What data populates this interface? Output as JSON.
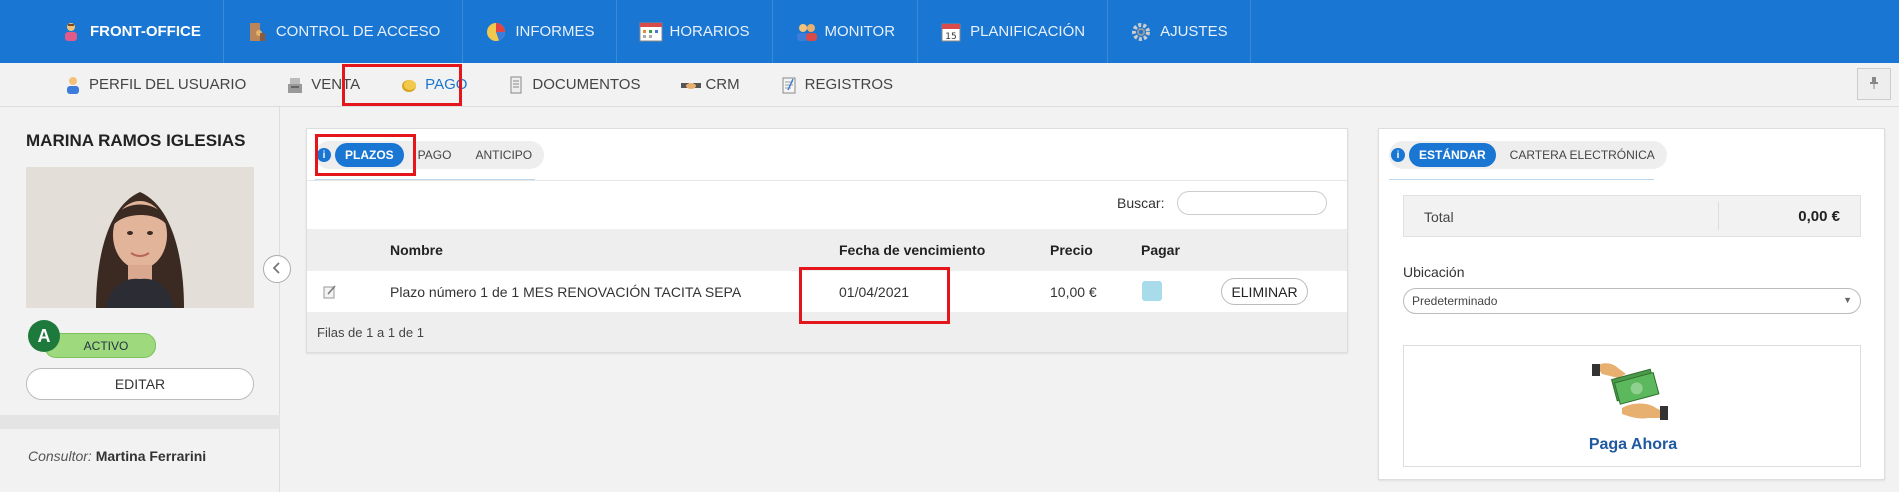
{
  "topnav": {
    "items": [
      {
        "label": "FRONT-OFFICE",
        "icon": "front-office-person-icon"
      },
      {
        "label": "CONTROL DE ACCESO",
        "icon": "access-control-icon"
      },
      {
        "label": "INFORMES",
        "icon": "pie-chart-icon"
      },
      {
        "label": "HORARIOS",
        "icon": "calendar-grid-icon"
      },
      {
        "label": "MONITOR",
        "icon": "people-icon"
      },
      {
        "label": "PLANIFICACIÓN",
        "icon": "calendar-icon"
      },
      {
        "label": "AJUSTES",
        "icon": "gear-icon"
      }
    ],
    "calendar_day": "15"
  },
  "subnav": {
    "items": [
      {
        "label": "PERFIL DEL USUARIO",
        "icon": "user-icon"
      },
      {
        "label": "VENTA",
        "icon": "cash-register-icon"
      },
      {
        "label": "PAGO",
        "icon": "coin-icon"
      },
      {
        "label": "DOCUMENTOS",
        "icon": "document-icon"
      },
      {
        "label": "CRM",
        "icon": "handshake-icon"
      },
      {
        "label": "REGISTROS",
        "icon": "notepad-icon"
      }
    ]
  },
  "sidebar": {
    "user_name": "MARINA RAMOS IGLESIAS",
    "status_letter": "A",
    "status_label": "ACTIVO",
    "edit_label": "EDITAR",
    "consultor_label": "Consultor:",
    "consultor_name": "Martina Ferrarini"
  },
  "main": {
    "info": "i",
    "tabs": [
      "PLAZOS",
      "PAGO",
      "ANTICIPO"
    ],
    "search_label": "Buscar:",
    "search_value": "",
    "columns": [
      "Nombre",
      "Fecha de vencimiento",
      "Precio",
      "Pagar"
    ],
    "rows": [
      {
        "nombre": "Plazo número 1 de 1 MES RENOVACIÓN TACITA SEPA",
        "fecha": "01/04/2021",
        "precio": "10,00 €",
        "action": "ELIMINAR"
      }
    ],
    "footer": "Filas de 1 a 1 de 1"
  },
  "right": {
    "info": "i",
    "tabs": [
      "ESTÁNDAR",
      "CARTERA ELECTRÓNICA"
    ],
    "total_label": "Total",
    "total_value": "0,00 €",
    "ubicacion_label": "Ubicación",
    "ubicacion_value": "Predeterminado",
    "pay_label": "Paga Ahora"
  },
  "colors": {
    "accent": "#1976d2",
    "highlight": "#e5151c",
    "active_status": "#9ed97e",
    "status_letter_bg": "#1e7a3c"
  }
}
